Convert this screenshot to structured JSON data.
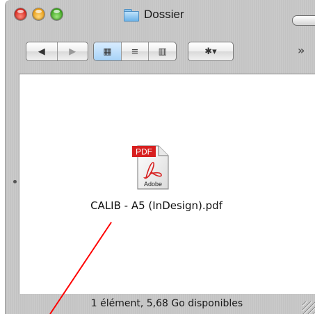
{
  "window": {
    "title": "Dossier",
    "icon": "folder-icon"
  },
  "toolbar": {
    "back_glyph": "◀",
    "forward_glyph": "▶",
    "view_icons_glyph": "▦",
    "view_list_glyph": "≡",
    "view_columns_glyph": "▥",
    "action_glyph": "✱▾",
    "overflow_glyph": "»",
    "selected_view": "icons"
  },
  "file": {
    "name": "CALIB - A5 (InDesign).pdf",
    "badge": "PDF",
    "brand": "Adobe",
    "icon": "pdf-file-icon"
  },
  "status": {
    "text": "1 élément, 5,68 Go disponibles"
  },
  "colors": {
    "annotation_line": "#ff0000",
    "pdf_badge": "#d71f1f",
    "selection_blue": "#a7d3f7"
  }
}
